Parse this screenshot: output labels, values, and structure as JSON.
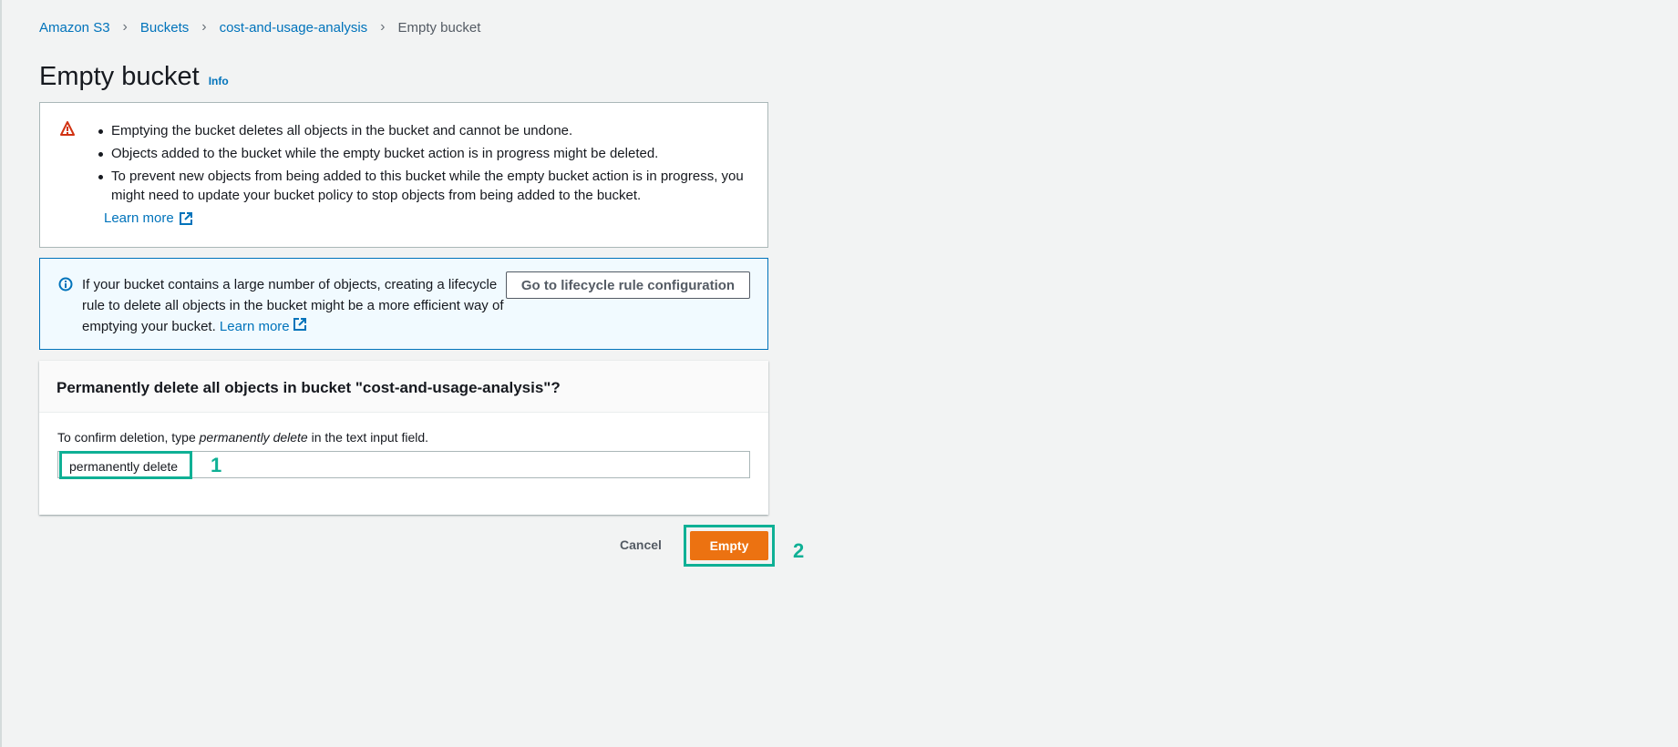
{
  "breadcrumb": [
    "Amazon S3",
    "Buckets",
    "cost-and-usage-analysis",
    "Empty bucket"
  ],
  "title": "Empty bucket",
  "info": "Info",
  "warning": {
    "items": [
      "Emptying the bucket deletes all objects in the bucket and cannot be undone.",
      "Objects added to the bucket while the empty bucket action is in progress might be deleted.",
      "To prevent new objects from being added to this bucket while the empty bucket action is in progress, you might need to update your bucket policy to stop objects from being added to the bucket."
    ],
    "learn_more": "Learn more"
  },
  "infobox": {
    "text": "If your bucket contains a large number of objects, creating a lifecycle rule to delete all objects in the bucket might be a more efficient way of emptying your bucket.",
    "learn_more": "Learn more",
    "button": "Go to lifecycle rule configuration"
  },
  "confirm": {
    "heading": "Permanently delete all objects in bucket \"cost-and-usage-analysis\"?",
    "label_pre": "To confirm deletion, type ",
    "label_em": "permanently delete",
    "label_post": " in the text input field.",
    "value": "permanently delete"
  },
  "annotations": [
    "1",
    "2"
  ],
  "actions": {
    "cancel": "Cancel",
    "empty": "Empty"
  },
  "colors": {
    "primary": "#ec7211",
    "link": "#0073bb",
    "highlight": "#0fb095",
    "warning": "#d13212"
  }
}
